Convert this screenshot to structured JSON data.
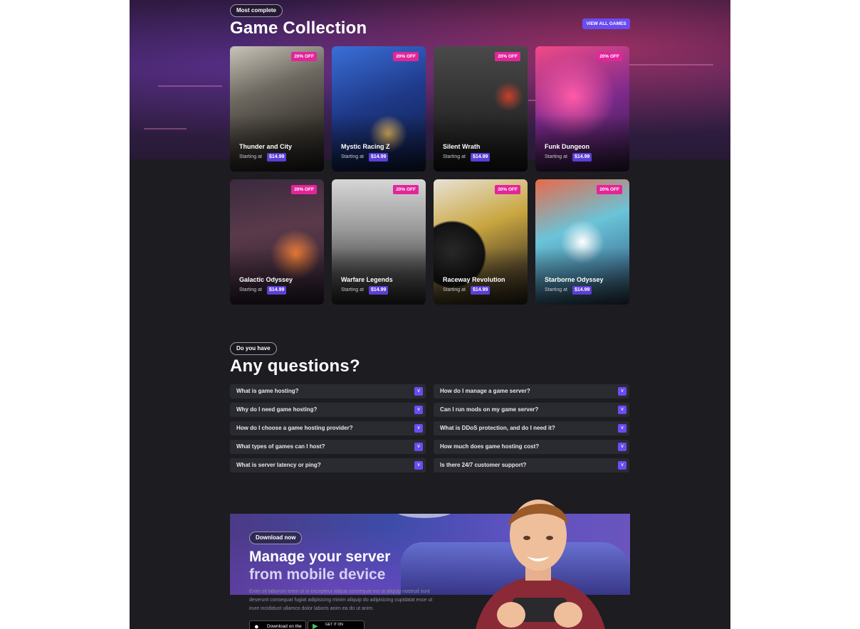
{
  "collection": {
    "eyebrow": "Most complete",
    "title": "Game Collection",
    "view_all": "VIEW ALL GAMES",
    "starting_label": "Starting at",
    "games": [
      {
        "name": "Thunder and City",
        "discount": "20% OFF",
        "price": "$14.99"
      },
      {
        "name": "Mystic Racing Z",
        "discount": "20% OFF",
        "price": "$14.99"
      },
      {
        "name": "Silent Wrath",
        "discount": "20% OFF",
        "price": "$14.99"
      },
      {
        "name": "Funk Dungeon",
        "discount": "20% OFF",
        "price": "$14.99"
      },
      {
        "name": "Galactic Odyssey",
        "discount": "20% OFF",
        "price": "$14.99"
      },
      {
        "name": "Warfare Legends",
        "discount": "20% OFF",
        "price": "$14.99"
      },
      {
        "name": "Raceway Revolution",
        "discount": "20% OFF",
        "price": "$14.99"
      },
      {
        "name": "Starborne Odyssey",
        "discount": "20% OFF",
        "price": "$14.99"
      }
    ]
  },
  "faq": {
    "eyebrow": "Do you have",
    "title": "Any questions?",
    "left": [
      "What is game hosting?",
      "Why do I need game hosting?",
      "How do I choose a game hosting provider?",
      "What types of games can I host?",
      "What is server latency or ping?"
    ],
    "right": [
      "How do I manage a game server?",
      "Can I run mods on my game server?",
      "What is DDoS protection, and do I need it?",
      "How much does game hosting cost?",
      "Is there 24/7 customer support?"
    ]
  },
  "download": {
    "eyebrow": "Download now",
    "title_line1": "Manage your server",
    "title_line2": "from mobile device",
    "description": "Enim sit laborum enim ut in excepteur aliqua consequat est ut aliquip nostrud sunt deserunt consequat fugiat adipisicing minim aliquip do adipisicing cupidatat esse ut irure incididunt ullamco dolor laboris anim ea do ut anim.",
    "app_store": "Download on the",
    "play_store": "GET IT ON"
  },
  "colors": {
    "accent": "#6b4cf0",
    "badge": "#e3259a",
    "background": "#1c1c21"
  }
}
